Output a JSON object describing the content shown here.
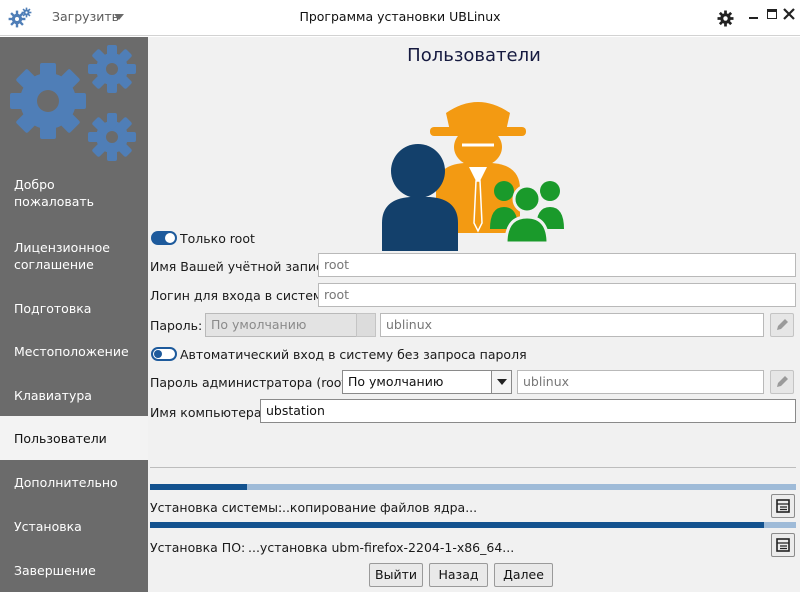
{
  "titlebar": {
    "load_label": "Загрузить",
    "title": "Программа установки UBLinux"
  },
  "sidebar": {
    "items": [
      {
        "label": "Добро пожаловать",
        "active": false
      },
      {
        "label": "Лицензионное соглашение",
        "active": false
      },
      {
        "label": "Подготовка",
        "active": false
      },
      {
        "label": "Местоположение",
        "active": false
      },
      {
        "label": "Клавиатура",
        "active": false
      },
      {
        "label": "Пользователи",
        "active": true
      },
      {
        "label": "Дополнительно",
        "active": false
      },
      {
        "label": "Установка",
        "active": false
      },
      {
        "label": "Завершение",
        "active": false
      }
    ]
  },
  "main": {
    "page_title": "Пользователи",
    "root_only": {
      "label": "Только root",
      "enabled": true
    },
    "account_name": {
      "label": "Имя Вашей учётной записи:",
      "value": "root"
    },
    "login": {
      "label": "Логин для входа в систему:",
      "value": "root"
    },
    "password": {
      "label": "Пароль:",
      "mode": "По умолчанию",
      "value": "ublinux"
    },
    "autologin": {
      "label": "Автоматический вход в систему без запроса пароля",
      "enabled": false
    },
    "admin_password": {
      "label": "Пароль администратора (root):",
      "mode": "По умолчанию",
      "value": "ublinux"
    },
    "hostname": {
      "label": "Имя компьютера:",
      "value": "ubstation"
    }
  },
  "progress": {
    "system": {
      "label": "Установка системы:",
      "status": "...копирование файлов ядра...",
      "fraction": 0.15
    },
    "software": {
      "label": "Установка ПО:",
      "status": "...установка ubm-firefox-2204-1-x86_64...",
      "fraction": 0.95
    }
  },
  "buttons": {
    "exit": "Выйти",
    "back": "Назад",
    "next": "Далее"
  },
  "colors": {
    "accent": "#1d5a9c",
    "sidebar_bg": "#6b6b6b",
    "gear": "#4f7eb7",
    "user_navy": "#13406b",
    "spy_orange": "#f39a12",
    "group_green": "#1a9a2b"
  },
  "icons": {
    "app": "gears-icon",
    "settings": "gear-icon",
    "edit": "pencil-icon",
    "log": "log-icon"
  }
}
